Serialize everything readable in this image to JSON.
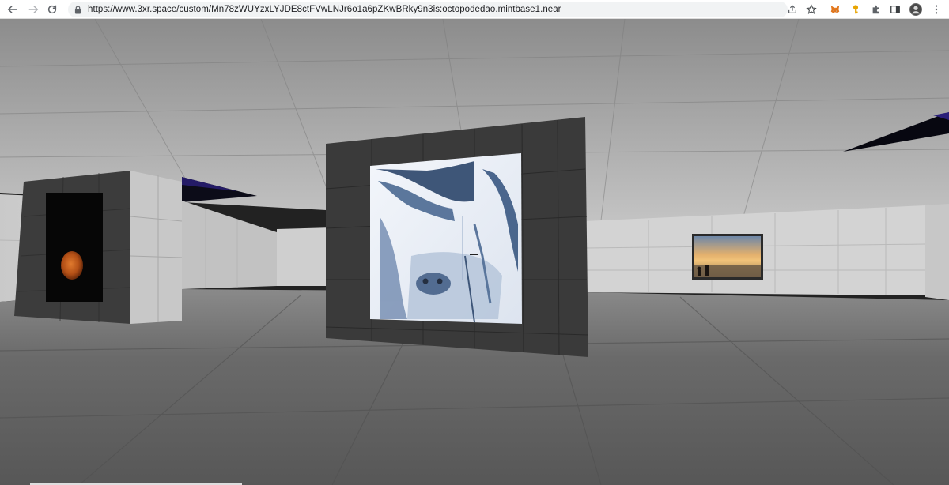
{
  "browser": {
    "url": "https://www.3xr.space/custom/Mn78zWUYzxLYJDE8ctFVwLNJr6o1a6pZKwBRky9n3is:octopodedao.mintbase1.near",
    "toolbar_icons": [
      "share-icon",
      "bookmark-star-icon",
      "metamask-fox-icon",
      "key-extension-icon",
      "extensions-puzzle-icon",
      "side-panel-icon",
      "profile-avatar",
      "menu-kebab-icon"
    ]
  },
  "scene": {
    "description_items": [
      "left-pillar-artwork",
      "center-pillar-artwork",
      "right-wall-artwork"
    ],
    "colors": {
      "ceiling": "#9a9a9a",
      "wall": "#cfcfcf",
      "floor": "#6e6e6e",
      "pillar": "#3a3a3a",
      "sky_accent": "#1b1740"
    }
  }
}
